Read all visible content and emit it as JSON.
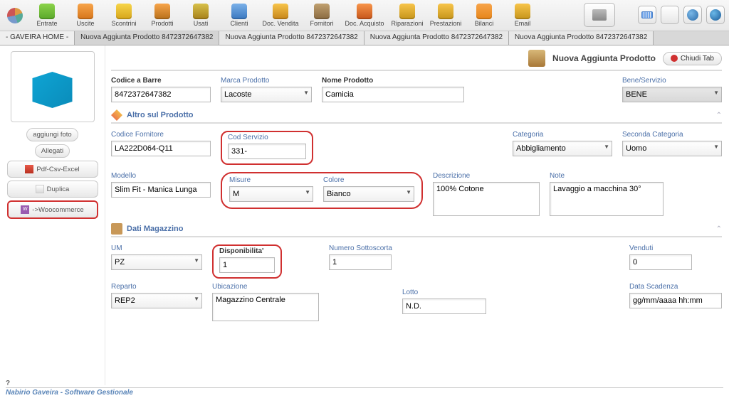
{
  "toolbar": {
    "items": [
      "Entrate",
      "Uscite",
      "Scontrini",
      "Prodotti",
      "Usati",
      "Clienti",
      "Doc. Vendita",
      "Fornitori",
      "Doc. Acquisto",
      "Riparazioni",
      "Prestazioni",
      "Bilanci",
      "Email"
    ]
  },
  "tabs": {
    "home": "- GAVEIRA HOME -",
    "list": [
      "Nuova Aggiunta Prodotto 8472372647382",
      "Nuova Aggiunta Prodotto 8472372647382",
      "Nuova Aggiunta Prodotto 8472372647382",
      "Nuova Aggiunta Prodotto 8472372647382"
    ]
  },
  "side": {
    "aggiungi_foto": "aggiungi foto",
    "allegati": "Allegati",
    "pdf": "Pdf-Csv-Excel",
    "duplica": "Duplica",
    "woo": "->Woocommerce"
  },
  "header": {
    "title": "Nuova Aggiunta Prodotto",
    "close": "Chiudi Tab"
  },
  "fields": {
    "codice_barre_l": "Codice a Barre",
    "codice_barre": "8472372647382",
    "marca_l": "Marca Prodotto",
    "marca": "Lacoste",
    "nome_l": "Nome Prodotto",
    "nome": "Camicia",
    "bene_l": "Bene/Servizio",
    "bene": "BENE",
    "sect_altro": "Altro sul Prodotto",
    "cod_forn_l": "Codice Fornitore",
    "cod_forn": "LA222D064-Q11",
    "cod_serv_l": "Cod Servizio",
    "cod_serv": "331-",
    "categoria_l": "Categoria",
    "categoria": "Abbigliamento",
    "seconda_cat_l": "Seconda Categoria",
    "seconda_cat": "Uomo",
    "modello_l": "Modello",
    "modello": "Slim Fit - Manica Lunga",
    "misure_l": "Misure",
    "misure": "M",
    "colore_l": "Colore",
    "colore": "Bianco",
    "descrizione_l": "Descrizione",
    "descrizione": "100% Cotone",
    "note_l": "Note",
    "note": "Lavaggio a macchina 30°",
    "sect_mag": "Dati Magazzino",
    "um_l": "UM",
    "um": "PZ",
    "disp_l": "Disponibilita'",
    "disp": "1",
    "sotto_l": "Numero Sottoscorta",
    "sotto": "1",
    "venduti_l": "Venduti",
    "venduti": "0",
    "ubic_l": "Ubicazione",
    "ubic": "Magazzino Centrale",
    "reparto_l": "Reparto",
    "reparto": "REP2",
    "lotto_l": "Lotto",
    "lotto": "N.D.",
    "scad_l": "Data Scadenza",
    "scad": "gg/mm/aaaa hh:mm"
  },
  "footer": {
    "help": "?",
    "app": "Nabirio Gaveira - Software Gestionale"
  }
}
